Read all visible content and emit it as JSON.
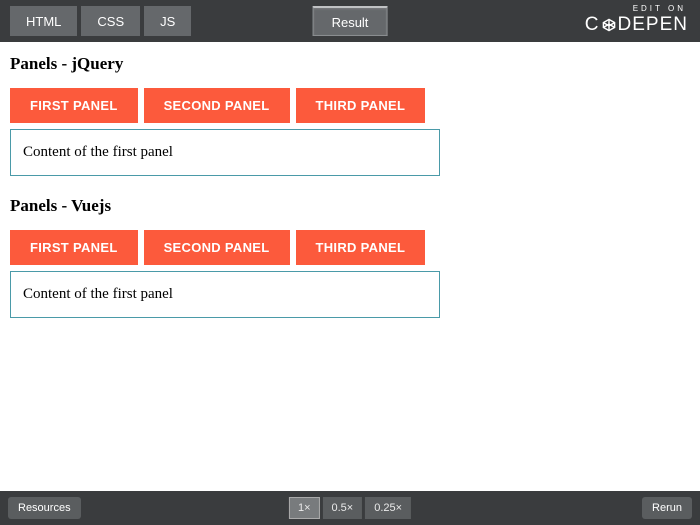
{
  "topbar": {
    "tabs": [
      "HTML",
      "CSS",
      "JS"
    ],
    "result": "Result",
    "edit_on": "EDIT ON",
    "brand_c": "C",
    "brand_rest": "DEPEN"
  },
  "sections": [
    {
      "title": "Panels - jQuery",
      "tabs": [
        "FIRST PANEL",
        "SECOND PANEL",
        "THIRD PANEL"
      ],
      "content": "Content of the first panel"
    },
    {
      "title": "Panels - Vuejs",
      "tabs": [
        "FIRST PANEL",
        "SECOND PANEL",
        "THIRD PANEL"
      ],
      "content": "Content of the first panel"
    }
  ],
  "bottombar": {
    "resources": "Resources",
    "zoom": [
      "1×",
      "0.5×",
      "0.25×"
    ],
    "rerun": "Rerun"
  }
}
